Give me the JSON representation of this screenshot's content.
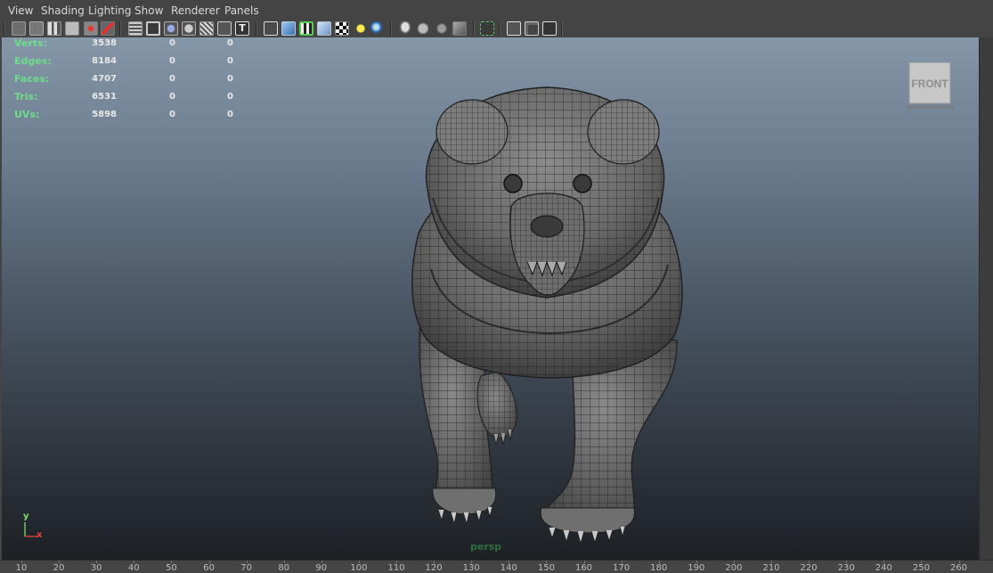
{
  "menus": [
    "View",
    "Shading",
    "Lighting",
    "Show",
    "Renderer",
    "Panels"
  ],
  "hud": {
    "rows": [
      {
        "label": "Verts:",
        "v1": "3538",
        "v2": "0",
        "v3": "0"
      },
      {
        "label": "Edges:",
        "v1": "8184",
        "v2": "0",
        "v3": "0"
      },
      {
        "label": "Faces:",
        "v1": "4707",
        "v2": "0",
        "v3": "0"
      },
      {
        "label": "Tris:",
        "v1": "6531",
        "v2": "0",
        "v3": "0"
      },
      {
        "label": "UVs:",
        "v1": "5898",
        "v2": "0",
        "v3": "0"
      }
    ]
  },
  "view_cube": {
    "label": "FRONT"
  },
  "camera": {
    "name": "persp"
  },
  "axis": {
    "y": "y",
    "x": "x"
  },
  "ruler": {
    "ticks": [
      "10",
      "20",
      "30",
      "40",
      "50",
      "60",
      "70",
      "80",
      "90",
      "100",
      "110",
      "120",
      "130",
      "140",
      "150",
      "160",
      "170",
      "180",
      "190",
      "200",
      "210",
      "220",
      "230",
      "240",
      "250",
      "260"
    ]
  },
  "toolbar_icons": [
    "camera-select-icon",
    "camera-lock-icon",
    "bookmarks-icon",
    "image-plane-icon",
    "grease-pencil-icon",
    "2d-pan-zoom-icon",
    "grid-icon",
    "film-gate-icon",
    "resolution-gate-icon",
    "gate-mask-icon",
    "field-chart-icon",
    "safe-title-icon",
    "wireframe-icon",
    "smooth-shade-icon",
    "wireframe-on-shaded-icon",
    "default-material-icon",
    "textured-icon",
    "use-all-lights-icon",
    "shadows-icon",
    "ambient-occlusion-icon",
    "motion-blur-icon",
    "anti-aliasing-icon",
    "isolate-select-icon",
    "xray-icon",
    "xray-joints-icon",
    "xray-components-icon"
  ],
  "colors": {
    "hud_label": "#6fdc8c",
    "cam_name": "#2d6e3e",
    "bg_top": "#8596a8",
    "bg_bottom": "#1d2126"
  }
}
